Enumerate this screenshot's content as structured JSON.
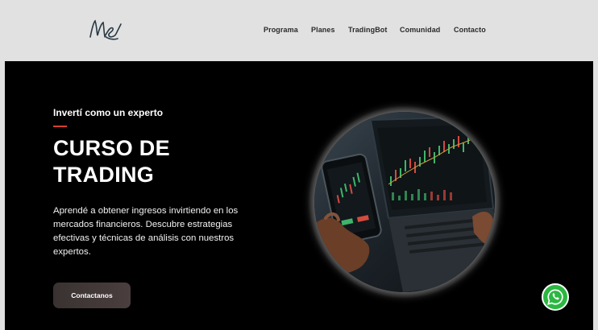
{
  "header": {
    "logo_text": "MS",
    "nav": [
      "Programa",
      "Planes",
      "TradingBot",
      "Comunidad",
      "Contacto"
    ]
  },
  "hero": {
    "eyebrow": "Invertí como un experto",
    "title_line1": "CURSO DE",
    "title_line2": "TRADING",
    "description": "Aprendé a obtener ingresos invirtiendo en los mercados financieros. Descubre estrategias efectivas y técnicas de análisis con nuestros expertos.",
    "cta_label": "Contactanos",
    "image_alt_icon": "trading-photo-icon"
  },
  "floating": {
    "icon": "whatsapp-icon"
  },
  "colors": {
    "accent": "#d8402d",
    "hero_bg": "#000000",
    "header_bg": "#e1e1e1",
    "whatsapp": "#2bb741"
  }
}
